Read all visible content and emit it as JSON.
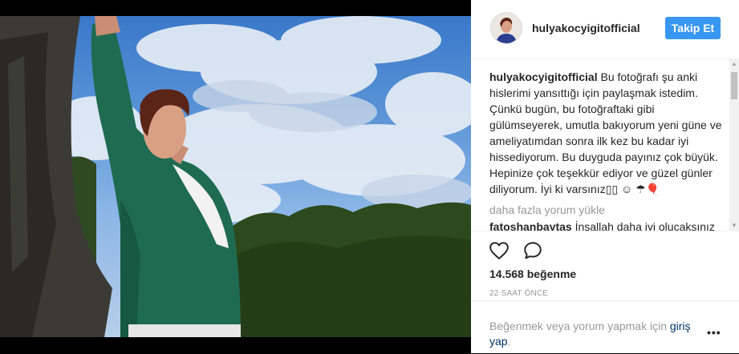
{
  "post": {
    "username": "hulyakocyigitofficial",
    "follow_label": "Takip Et",
    "caption": "Bu fotoğrafı şu anki hislerimi yansıttığı için paylaşmak istedim. Çünkü bugün, bu fotoğraftaki gibi gülümseyerek, umutla bakıyorum yeni güne ve ameliyatımdan sonra ilk kez bu kadar iyi hissediyorum. Bu duyguda payınız çok büyük. Hepinize çok teşekkür ediyor ve güzel günler diliyorum. İyi ki varsınız▯▯ ☺ ☂🎈",
    "load_more_label": "daha fazla yorum yükle",
    "partial_comment": {
      "user": "fatoshanbaytas",
      "text": "İnşallah daha iyi olucaksınız"
    },
    "likes_label": "14.568 beğenme",
    "timestamp": "22 SAAT ÖNCE",
    "login_prompt": "Beğenmek veya yorum yapmak için ",
    "login_link": "giriş yap",
    "login_suffix": ".",
    "more_options": "•••"
  },
  "icons": {
    "heart": "heart-outline-icon",
    "comment": "speech-bubble-icon"
  },
  "colors": {
    "follow_button": "#3897f0",
    "link": "#003569",
    "muted_text": "#999999"
  }
}
